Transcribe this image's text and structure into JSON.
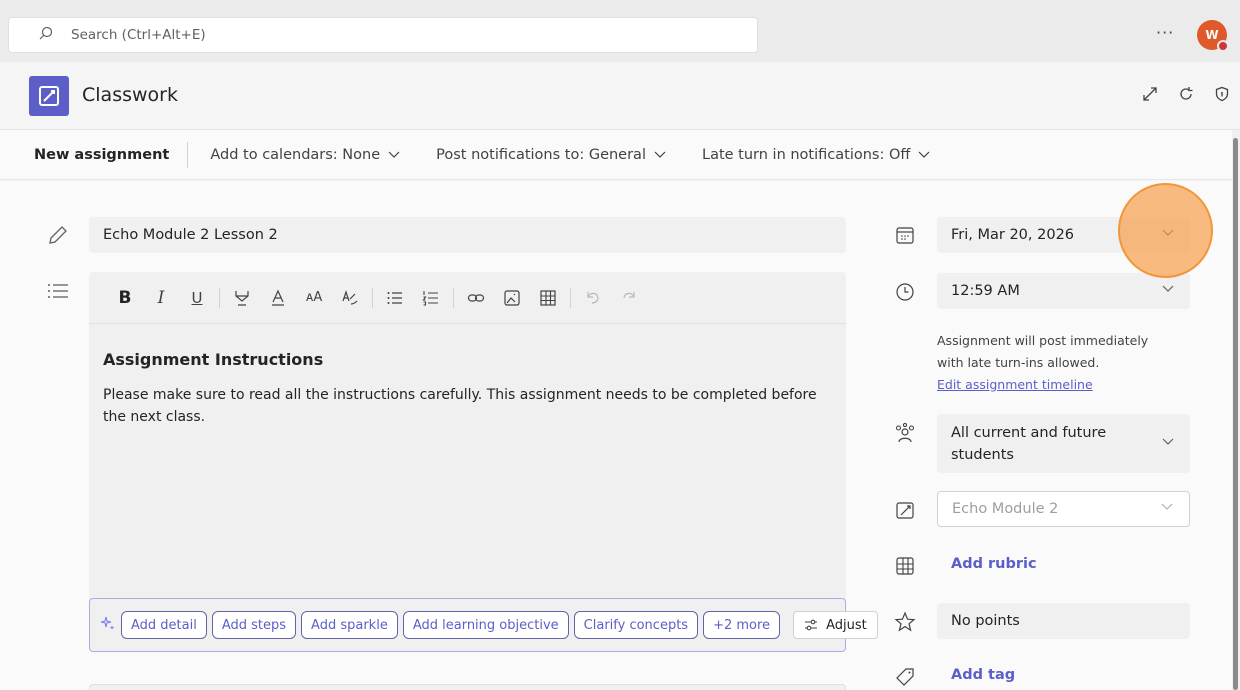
{
  "search": {
    "placeholder": "Search (Ctrl+Alt+E)"
  },
  "topbar": {
    "more_label": "···",
    "avatar_initials": "W"
  },
  "app": {
    "title": "Classwork"
  },
  "toolbar": {
    "new_assignment": "New assignment",
    "add_to_calendars": "Add to calendars: None",
    "post_notifications": "Post notifications to: General",
    "late_turn_in": "Late turn in notifications: Off"
  },
  "assignment": {
    "title": "Echo Module 2 Lesson 2",
    "instructions_heading": "Assignment Instructions",
    "instructions_body": "Please make sure to read all the instructions carefully. This assignment needs to be completed before the next class."
  },
  "ai_suggestions": {
    "chips": [
      "Add detail",
      "Add steps",
      "Add sparkle",
      "Add learning objective",
      "Clarify concepts",
      "+2 more"
    ],
    "adjust_label": "Adjust"
  },
  "schedule": {
    "due_date": "Fri, Mar 20, 2026",
    "due_time": "12:59 AM",
    "note": "Assignment will post immediately with late turn-ins allowed.",
    "edit_timeline": "Edit assignment timeline"
  },
  "assign_to": {
    "value": "All current and future students"
  },
  "category": {
    "placeholder": "Echo Module 2"
  },
  "rubric": {
    "label": "Add rubric"
  },
  "points": {
    "value": "No points"
  },
  "tag": {
    "label": "Add tag"
  },
  "colors": {
    "accent": "#5b5fc7",
    "cursor_highlight": "#f7983c",
    "avatar": "#e0592a"
  }
}
